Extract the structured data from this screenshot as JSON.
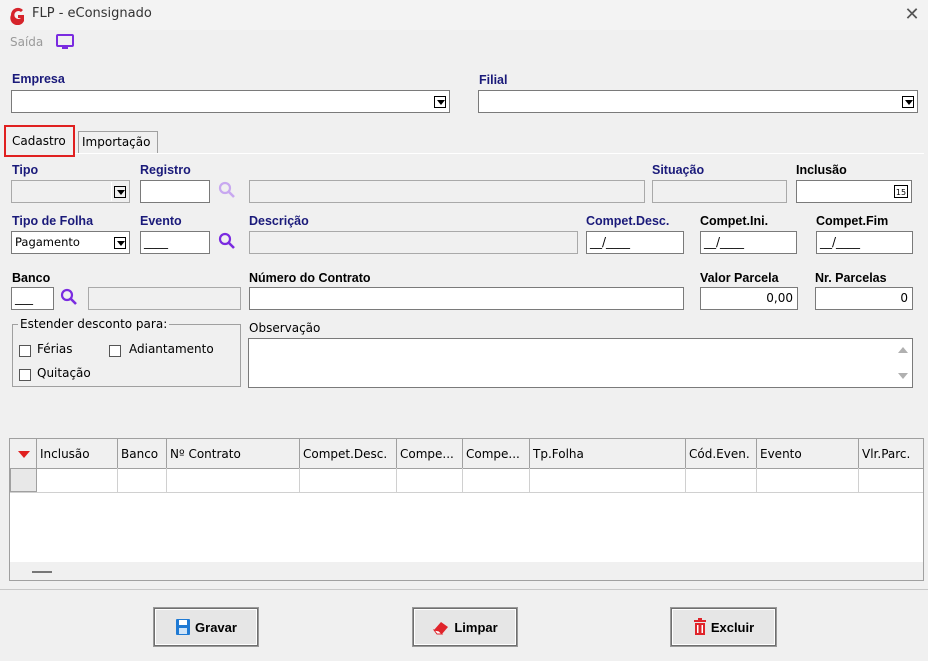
{
  "window": {
    "title": "FLP - eConsignado",
    "close_icon": "close-icon"
  },
  "menu": {
    "saida_label": "Saída"
  },
  "empresa": {
    "label": "Empresa",
    "value": ""
  },
  "filial": {
    "label": "Filial",
    "value": ""
  },
  "tabs": [
    {
      "label": "Cadastro",
      "active": true
    },
    {
      "label": "Importação",
      "active": false
    }
  ],
  "form": {
    "tipo_label": "Tipo",
    "registro_label": "Registro",
    "situacao_label": "Situação",
    "inclusao_label": "Inclusão",
    "tipo_folha_label": "Tipo de Folha",
    "tipo_folha_value": "Pagamento",
    "evento_label": "Evento",
    "evento_value": "____",
    "descricao_label": "Descrição",
    "compet_desc_label": "Compet.Desc.",
    "compet_desc_value": "__/____",
    "compet_ini_label": "Compet.Ini.",
    "compet_ini_value": "__/____",
    "compet_fim_label": "Compet.Fim",
    "compet_fim_value": "__/____",
    "banco_label": "Banco",
    "banco_value": "___",
    "numero_contrato_label": "Número do Contrato",
    "valor_parcela_label": "Valor Parcela",
    "valor_parcela_value": "0,00",
    "nr_parcelas_label": "Nr. Parcelas",
    "nr_parcelas_value": "0",
    "estender_label": "Estender desconto para:",
    "ferias_label": "Férias",
    "adiantamento_label": "Adiantamento",
    "quitacao_label": "Quitação",
    "observacao_label": "Observação",
    "calendar_icon_text": "15"
  },
  "grid": {
    "columns": [
      "Inclusão",
      "Banco",
      "Nº Contrato",
      "Compet.Desc.",
      "Compe...",
      "Compe...",
      "Tp.Folha",
      "Cód.Even.",
      "Evento",
      "Vlr.Parc."
    ]
  },
  "buttons": {
    "gravar": "Gravar",
    "limpar": "Limpar",
    "excluir": "Excluir"
  },
  "colors": {
    "accent_purple": "#7a2be0",
    "tab_highlight": "#e02020",
    "label_blue": "#1a1a7a"
  }
}
